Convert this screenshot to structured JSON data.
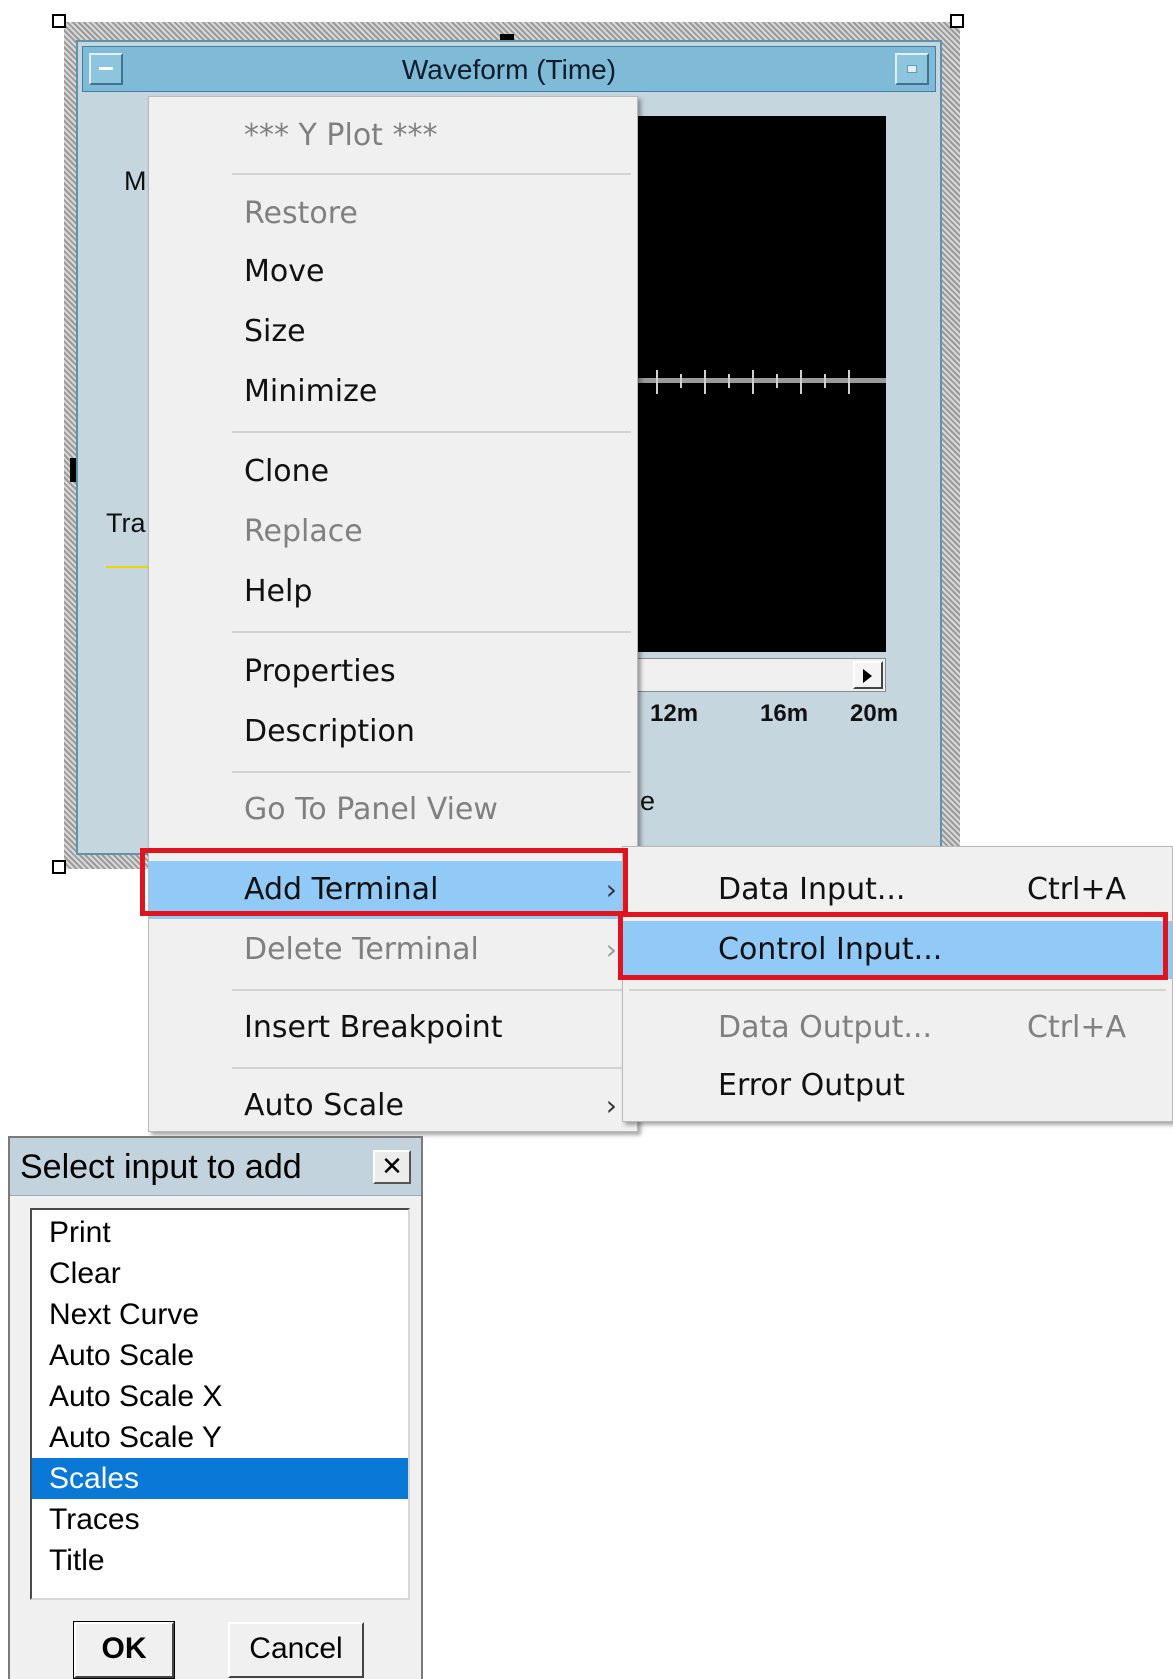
{
  "waveform_window": {
    "title": "Waveform (Time)",
    "side_label_top": "M",
    "side_label_mid": "Tra",
    "bottom_text": "e",
    "x_ticks": [
      "12m",
      "16m",
      "20m"
    ]
  },
  "context_menu": {
    "items": [
      {
        "label": "*** Y Plot ***",
        "enabled": false
      },
      {
        "label": "Restore",
        "enabled": false
      },
      {
        "label": "Move",
        "enabled": true
      },
      {
        "label": "Size",
        "enabled": true
      },
      {
        "label": "Minimize",
        "enabled": true
      },
      {
        "label": "Clone",
        "enabled": true
      },
      {
        "label": "Replace",
        "enabled": false
      },
      {
        "label": "Help",
        "enabled": true
      },
      {
        "label": "Properties",
        "enabled": true
      },
      {
        "label": "Description",
        "enabled": true
      },
      {
        "label": "Go To Panel View",
        "enabled": false
      },
      {
        "label": "Add Terminal",
        "enabled": true,
        "submenu": true,
        "highlighted": true
      },
      {
        "label": "Delete Terminal",
        "enabled": false,
        "submenu": true
      },
      {
        "label": "Insert Breakpoint",
        "enabled": true
      },
      {
        "label": "Auto Scale",
        "enabled": true,
        "submenu": true
      }
    ],
    "chevron": "›"
  },
  "submenu": {
    "items": [
      {
        "label": "Data Input...",
        "shortcut": "Ctrl+A",
        "enabled": true
      },
      {
        "label": "Control Input...",
        "shortcut": "",
        "enabled": true,
        "highlighted": true
      },
      {
        "label": "Data Output...",
        "shortcut": "Ctrl+A",
        "enabled": false
      },
      {
        "label": "Error Output",
        "shortcut": "",
        "enabled": true
      }
    ]
  },
  "dialog": {
    "title": "Select input to add",
    "close_glyph": "✕",
    "options": [
      "Print",
      "Clear",
      "Next Curve",
      "Auto Scale",
      "Auto Scale X",
      "Auto Scale Y",
      "Scales",
      "Traces",
      "Title"
    ],
    "selected": "Scales",
    "ok_label": "OK",
    "cancel_label": "Cancel"
  },
  "colors": {
    "menu_highlight": "#91c9f7",
    "annotation_red": "#e0141e",
    "list_selected": "#0a78d7",
    "title_bar": "#7fbad6"
  }
}
